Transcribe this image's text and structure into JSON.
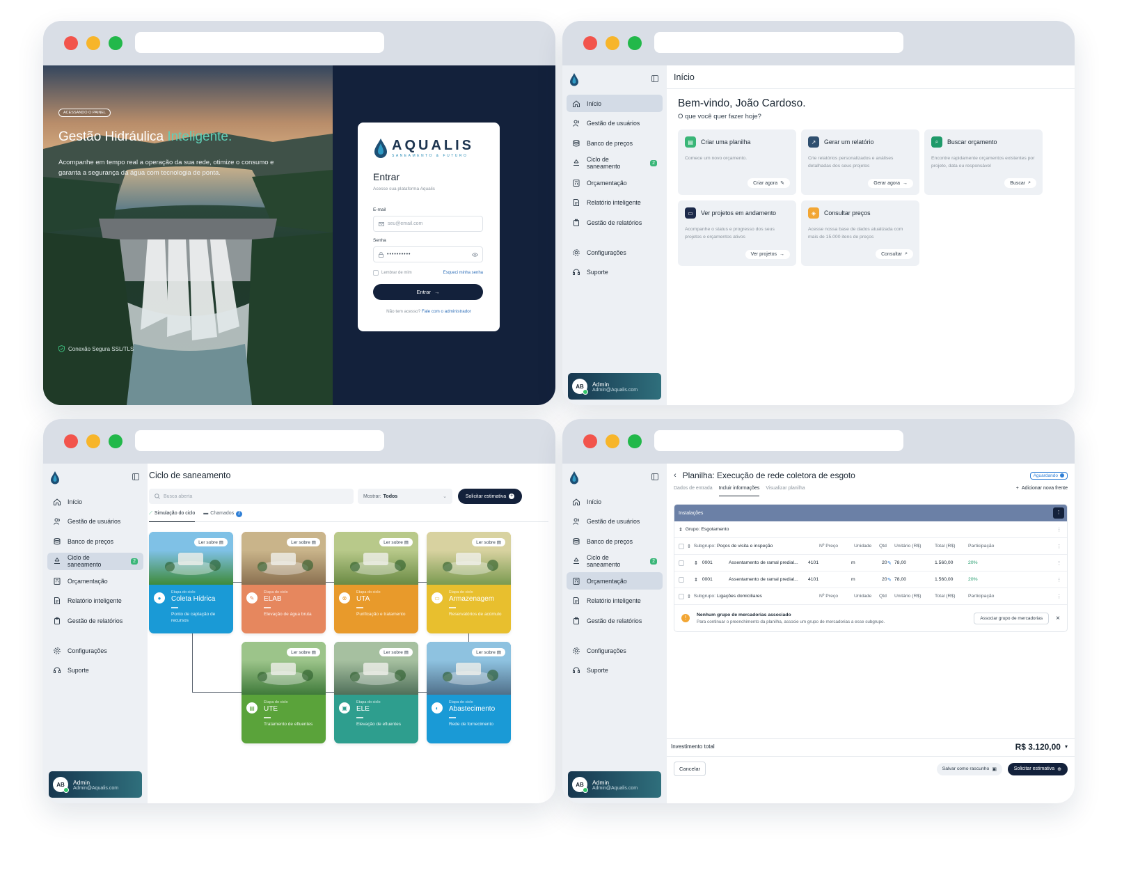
{
  "login": {
    "tag": "ACESSANDO O PAINEL",
    "title_main": "Gestão Hidráulica",
    "title_accent": "Inteligente.",
    "description": "Acompanhe em tempo real a operação da sua rede, otimize o consumo e garanta a segurança da água com tecnologia de ponta.",
    "secure_note": "Conexão Segura SSL/TLS",
    "brand": "AQUALIS",
    "brand_tagline": "SANEAMENTO & FUTURO",
    "heading": "Entrar",
    "subheading": "Acesse sua plataforma Aqualis",
    "email_label": "E-mail",
    "email_placeholder": "seu@email.com",
    "password_label": "Senha",
    "password_value": "••••••••••",
    "remember": "Lembrar de mim",
    "forgot": "Esqueci minha senha",
    "submit": "Entrar",
    "no_access": "Não tem acesso?",
    "contact_admin": "Fale com o administrador"
  },
  "sidebar": {
    "items": [
      "Início",
      "Gestão de usuários",
      "Banco de preços",
      "Ciclo de saneamento",
      "Orçamentação",
      "Relatório inteligente",
      "Gestão de relatórios"
    ],
    "cycle_badge": "2",
    "settings": "Configurações",
    "support": "Suporte",
    "user_initials": "AB",
    "user_name": "Admin",
    "user_email": "Admin@Aqualis.com"
  },
  "dashboard": {
    "page_title": "Início",
    "welcome": "Bem-vindo, João Cardoso.",
    "question": "O que você quer fazer hoje?",
    "tiles": [
      {
        "title": "Criar uma planilha",
        "desc": "Comece um novo orçamento.",
        "button": "Criar agora",
        "color": "#3ab678"
      },
      {
        "title": "Gerar um relatório",
        "desc": "Crie relatórios personalizados e análises detalhadas dos seus projetos",
        "button": "Gerar agora",
        "color": "#2f4f6f"
      },
      {
        "title": "Buscar orçamento",
        "desc": "Encontre rapidamente orçamentos existentes por projeto, data ou responsável",
        "button": "Buscar",
        "color": "#1f9a6a"
      },
      {
        "title": "Ver projetos em andamento",
        "desc": "Acompanhe o status e progresso dos seus projetos e orçamentos ativos",
        "button": "Ver projetos",
        "color": "#1c2a4a"
      },
      {
        "title": "Consultar preços",
        "desc": "Acesse nossa base de dados atualizada com mais de 15.000 itens de preços",
        "button": "Consultar",
        "color": "#f2a634"
      }
    ]
  },
  "cycle": {
    "page_title": "Ciclo de saneamento",
    "search_placeholder": "Busca aberta",
    "show_label": "Mostrar:",
    "show_value": "Todos",
    "request_button": "Solicitar estimativa",
    "tab_simulation": "Simulação do ciclo",
    "tab_tickets": "Chamados",
    "tickets_count": "2",
    "stage_label": "Etapa do ciclo",
    "read_label": "Ler sobre",
    "cards": [
      {
        "name": "Coleta Hídrica",
        "sub": "Ponto de captação de recursos",
        "color": "#1a9ad6"
      },
      {
        "name": "ELAB",
        "sub": "Elevação de água bruta",
        "color": "#e6875e"
      },
      {
        "name": "UTA",
        "sub": "Purificação e tratamento",
        "color": "#e89a2b"
      },
      {
        "name": "Armazenagem",
        "sub": "Reservatórios de acúmulo",
        "color": "#e8bf2e"
      },
      {
        "name": "UTE",
        "sub": "Tratamento de efluentes",
        "color": "#5aa33a"
      },
      {
        "name": "ELE",
        "sub": "Elevação de efluentes",
        "color": "#2e9e8e"
      },
      {
        "name": "Abastecimento",
        "sub": "Rede de fornecimento",
        "color": "#1a9ad6"
      }
    ]
  },
  "sheet": {
    "title": "Planilha: Execução de rede coletora de esgoto",
    "status": "Aguardando",
    "tabs": [
      "Dados de entrada",
      "Incluir informações",
      "Visualizar planilha"
    ],
    "add_front": "Adicionar nova frente",
    "section": "Instalações",
    "group_label": "Grupo:",
    "group_name": "Esgotamento",
    "subgroup_label": "Subgrupo:",
    "subgroup1": "Poços de visita e inspeção",
    "subgroup2": "Ligações domiciliares",
    "columns": [
      "Nº Preço",
      "Unidade",
      "Qtd",
      "Unitário (R$)",
      "Total (R$)",
      "Participação"
    ],
    "rows": [
      {
        "code": "0001",
        "desc": "Assentamento de ramal predial...",
        "price_no": "4101",
        "unit": "m",
        "qty": "20",
        "unit_price": "78,00",
        "total": "1.560,00",
        "share": "20%"
      },
      {
        "code": "0001",
        "desc": "Assentamento de ramal predial...",
        "price_no": "4101",
        "unit": "m",
        "qty": "20",
        "unit_price": "78,00",
        "total": "1.560,00",
        "share": "20%"
      }
    ],
    "alert_title": "Nenhum grupo de mercadorias associado",
    "alert_text": "Para continuar o preenchimento da planilha, associe um grupo de mercadorias a esse subgrupo.",
    "alert_button": "Associar grupo de mercadorias",
    "total_label": "Investimento total",
    "total_value": "R$ 3.120,00",
    "cancel": "Cancelar",
    "save_draft": "Salvar como rascunho",
    "request": "Solicitar estimativa"
  }
}
